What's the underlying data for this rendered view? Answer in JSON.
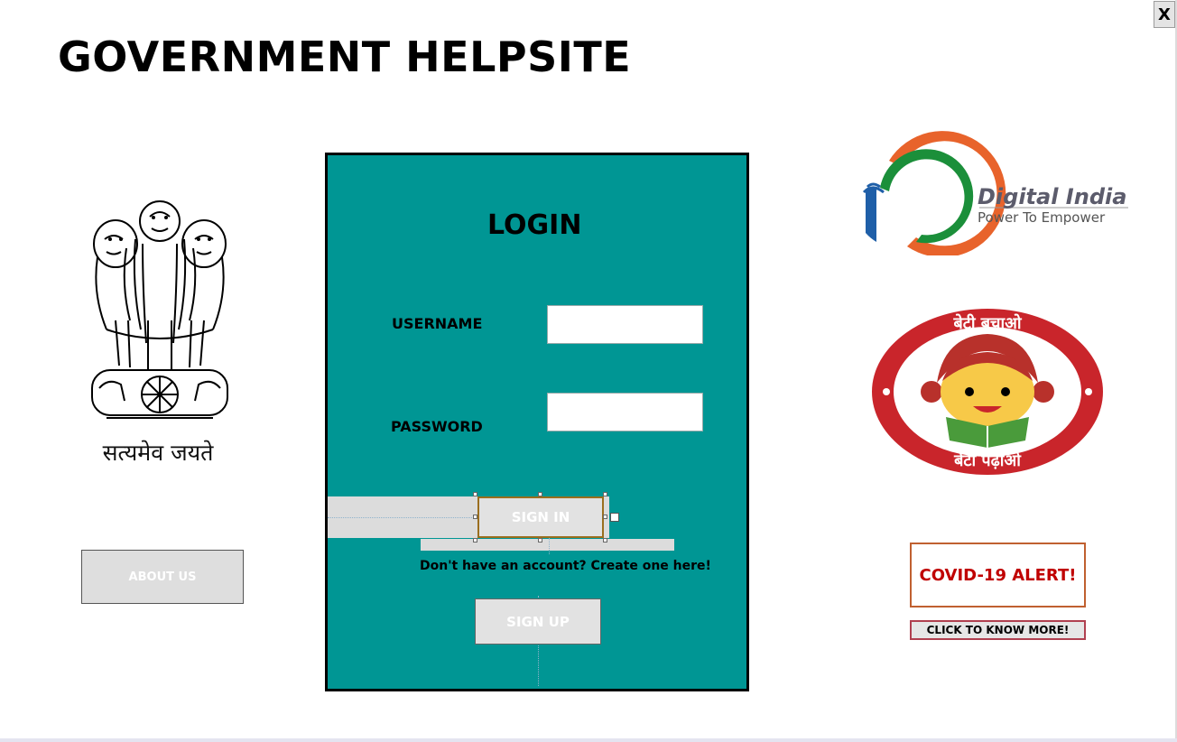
{
  "window": {
    "close_label": "X"
  },
  "header": {
    "title": "GOVERNMENT HELPSITE"
  },
  "left_panel": {
    "emblem_icon": "ashoka-emblem-icon",
    "motto": "सत्यमेव जयते",
    "about_label": "ABOUT US"
  },
  "login": {
    "title": "LOGIN",
    "username_label": "USERNAME",
    "username_value": "",
    "password_label": "PASSWORD",
    "password_value": "",
    "signin_label": "SIGN IN",
    "create_account_text": "Don't have an account? Create one here!",
    "signup_label": "SIGN UP",
    "panel_color": "#009694"
  },
  "right_panel": {
    "digital_india": {
      "name": "Digital India",
      "tagline": "Power To Empower"
    },
    "bbbp": {
      "top_text": "बेटी बचाओ",
      "bottom_text": "बेटी पढ़ाओ"
    },
    "covid_alert": "COVID-19 ALERT!",
    "know_more_label": "CLICK TO KNOW MORE!"
  }
}
